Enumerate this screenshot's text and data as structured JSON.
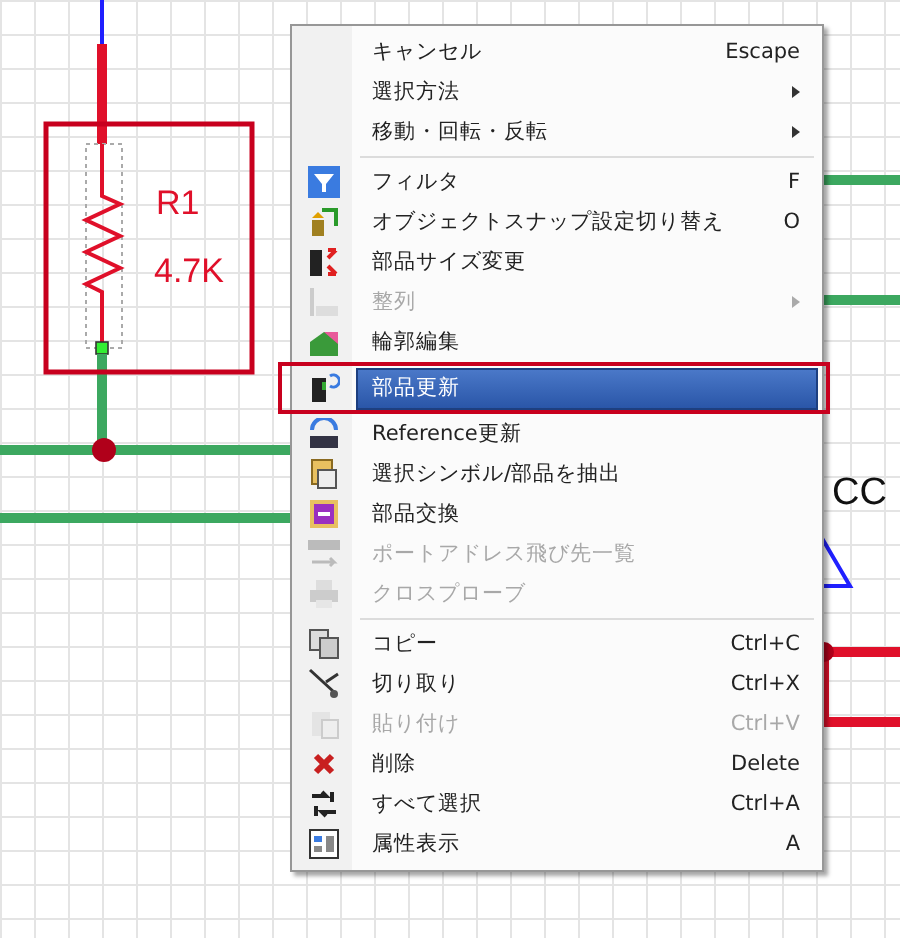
{
  "canvas": {
    "part_name": "R1",
    "part_value": "4.7K",
    "net_label": "CC"
  },
  "context_menu": {
    "items": [
      {
        "kind": "item",
        "label": "キャンセル",
        "shortcut": "Escape",
        "submenu": false,
        "disabled": false,
        "selected": false
      },
      {
        "kind": "item",
        "label": "選択方法",
        "submenu": true,
        "disabled": false,
        "selected": false
      },
      {
        "kind": "item",
        "label": "移動・回転・反転",
        "submenu": true,
        "disabled": false,
        "selected": false
      },
      {
        "kind": "separator"
      },
      {
        "kind": "item",
        "label": "フィルタ",
        "shortcut": "F",
        "submenu": false,
        "disabled": false,
        "selected": false
      },
      {
        "kind": "item",
        "label": "オブジェクトスナップ設定切り替え",
        "shortcut": "O",
        "submenu": false,
        "disabled": false,
        "selected": false
      },
      {
        "kind": "item",
        "label": "部品サイズ変更",
        "submenu": false,
        "disabled": false,
        "selected": false
      },
      {
        "kind": "item",
        "label": "整列",
        "submenu": true,
        "disabled": true,
        "selected": false
      },
      {
        "kind": "item",
        "label": "輪郭編集",
        "submenu": false,
        "disabled": false,
        "selected": false
      },
      {
        "kind": "item",
        "label": "部品更新",
        "submenu": false,
        "disabled": false,
        "selected": true
      },
      {
        "kind": "item",
        "label": "Reference更新",
        "submenu": false,
        "disabled": false,
        "selected": false
      },
      {
        "kind": "item",
        "label": "選択シンボル/部品を抽出",
        "submenu": false,
        "disabled": false,
        "selected": false
      },
      {
        "kind": "item",
        "label": "部品交換",
        "submenu": false,
        "disabled": false,
        "selected": false
      },
      {
        "kind": "item",
        "label": "ポートアドレス飛び先一覧",
        "submenu": false,
        "disabled": true,
        "selected": false
      },
      {
        "kind": "item",
        "label": "クロスプローブ",
        "submenu": false,
        "disabled": true,
        "selected": false
      },
      {
        "kind": "separator"
      },
      {
        "kind": "item",
        "label": "コピー",
        "shortcut": "Ctrl+C",
        "submenu": false,
        "disabled": false,
        "selected": false
      },
      {
        "kind": "item",
        "label": "切り取り",
        "shortcut": "Ctrl+X",
        "submenu": false,
        "disabled": false,
        "selected": false
      },
      {
        "kind": "item",
        "label": "貼り付け",
        "shortcut": "Ctrl+V",
        "submenu": false,
        "disabled": true,
        "selected": false
      },
      {
        "kind": "item",
        "label": "削除",
        "shortcut": "Delete",
        "submenu": false,
        "disabled": false,
        "selected": false
      },
      {
        "kind": "item",
        "label": "すべて選択",
        "shortcut": "Ctrl+A",
        "submenu": false,
        "disabled": false,
        "selected": false
      },
      {
        "kind": "item",
        "label": "属性表示",
        "shortcut": "A",
        "submenu": false,
        "disabled": false,
        "selected": false
      }
    ]
  }
}
